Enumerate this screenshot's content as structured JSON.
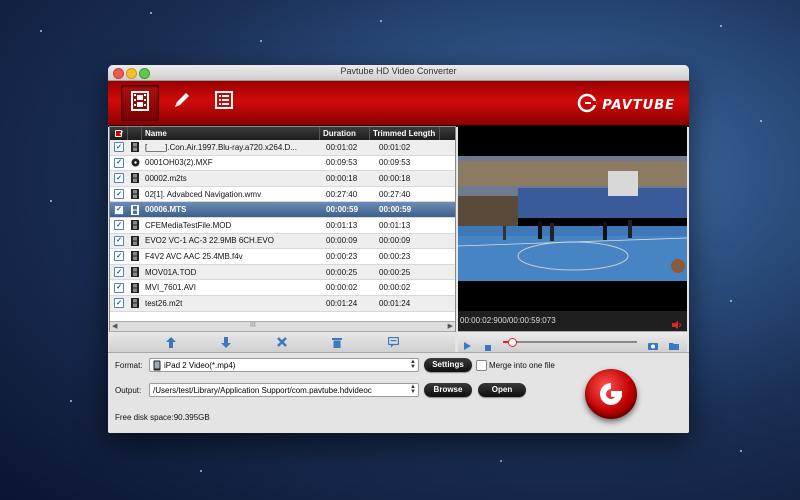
{
  "window": {
    "title": "Pavtube HD Video Converter"
  },
  "toolbar": {
    "tools": [
      {
        "name": "film-edit",
        "icon": "film-icon",
        "active": true
      },
      {
        "name": "edit",
        "icon": "pen-icon",
        "active": false
      },
      {
        "name": "task-list",
        "icon": "list-icon",
        "active": false
      }
    ],
    "brand": "PAVTUBE"
  },
  "list": {
    "headers": {
      "name": "Name",
      "duration": "Duration",
      "trimmed": "Trimmed Length"
    },
    "rows": [
      {
        "name": "[____].Con.Air.1997.Blu-ray.a720.x264.D...",
        "duration": "00:01:02",
        "trimmed": "00:01:02",
        "icon": "film-icon",
        "checked": true,
        "selected": false
      },
      {
        "name": "0001OH03(2).MXF",
        "duration": "00:09:53",
        "trimmed": "00:09:53",
        "icon": "disc-icon",
        "checked": true,
        "selected": false
      },
      {
        "name": "00002.m2ts",
        "duration": "00:00:18",
        "trimmed": "00:00:18",
        "icon": "film-icon",
        "checked": true,
        "selected": false
      },
      {
        "name": "02[1]. Advabced Navigation.wmv",
        "duration": "00:27:40",
        "trimmed": "00:27:40",
        "icon": "film-icon",
        "checked": true,
        "selected": false
      },
      {
        "name": "00006.MTS",
        "duration": "00:00:59",
        "trimmed": "00:00:59",
        "icon": "film-icon",
        "checked": true,
        "selected": true
      },
      {
        "name": "CFEMediaTestFile.MOD",
        "duration": "00:01:13",
        "trimmed": "00:01:13",
        "icon": "film-icon",
        "checked": true,
        "selected": false
      },
      {
        "name": "EVO2 VC-1 AC-3 22.9MB 6CH.EVO",
        "duration": "00:00:09",
        "trimmed": "00:00:09",
        "icon": "film-icon",
        "checked": true,
        "selected": false
      },
      {
        "name": "F4V2 AVC AAC 25.4MB.f4v",
        "duration": "00:00:23",
        "trimmed": "00:00:23",
        "icon": "film-icon",
        "checked": true,
        "selected": false
      },
      {
        "name": "MOV01A.TOD",
        "duration": "00:00:25",
        "trimmed": "00:00:25",
        "icon": "film-icon",
        "checked": true,
        "selected": false
      },
      {
        "name": "MVI_7601.AVI",
        "duration": "00:00:02",
        "trimmed": "00:00:02",
        "icon": "film-icon",
        "checked": true,
        "selected": false
      },
      {
        "name": "test26.m2t",
        "duration": "00:01:24",
        "trimmed": "00:01:24",
        "icon": "film-icon",
        "checked": true,
        "selected": false
      }
    ],
    "scroll_grip": "III"
  },
  "list_tools": [
    "move-up-icon",
    "move-down-icon",
    "remove-icon",
    "trash-icon",
    "subtitle-icon"
  ],
  "player": {
    "timecode": "00:00:02:900/00:00:59:073",
    "progress": 0.06
  },
  "bottom": {
    "format_label": "Format:",
    "format_value": "iPad 2 Video(*.mp4)",
    "settings_label": "Settings",
    "merge_label": "Merge into one file",
    "merge_checked": false,
    "output_label": "Output:",
    "output_value": "/Users/test/Library/Application Support/com.pavtube.hdvideoc",
    "browse_label": "Browse",
    "open_label": "Open",
    "disk_space": "Free disk space:90.395GB"
  },
  "colors": {
    "brand_red": "#c80000",
    "selection": "#4a6d99"
  }
}
